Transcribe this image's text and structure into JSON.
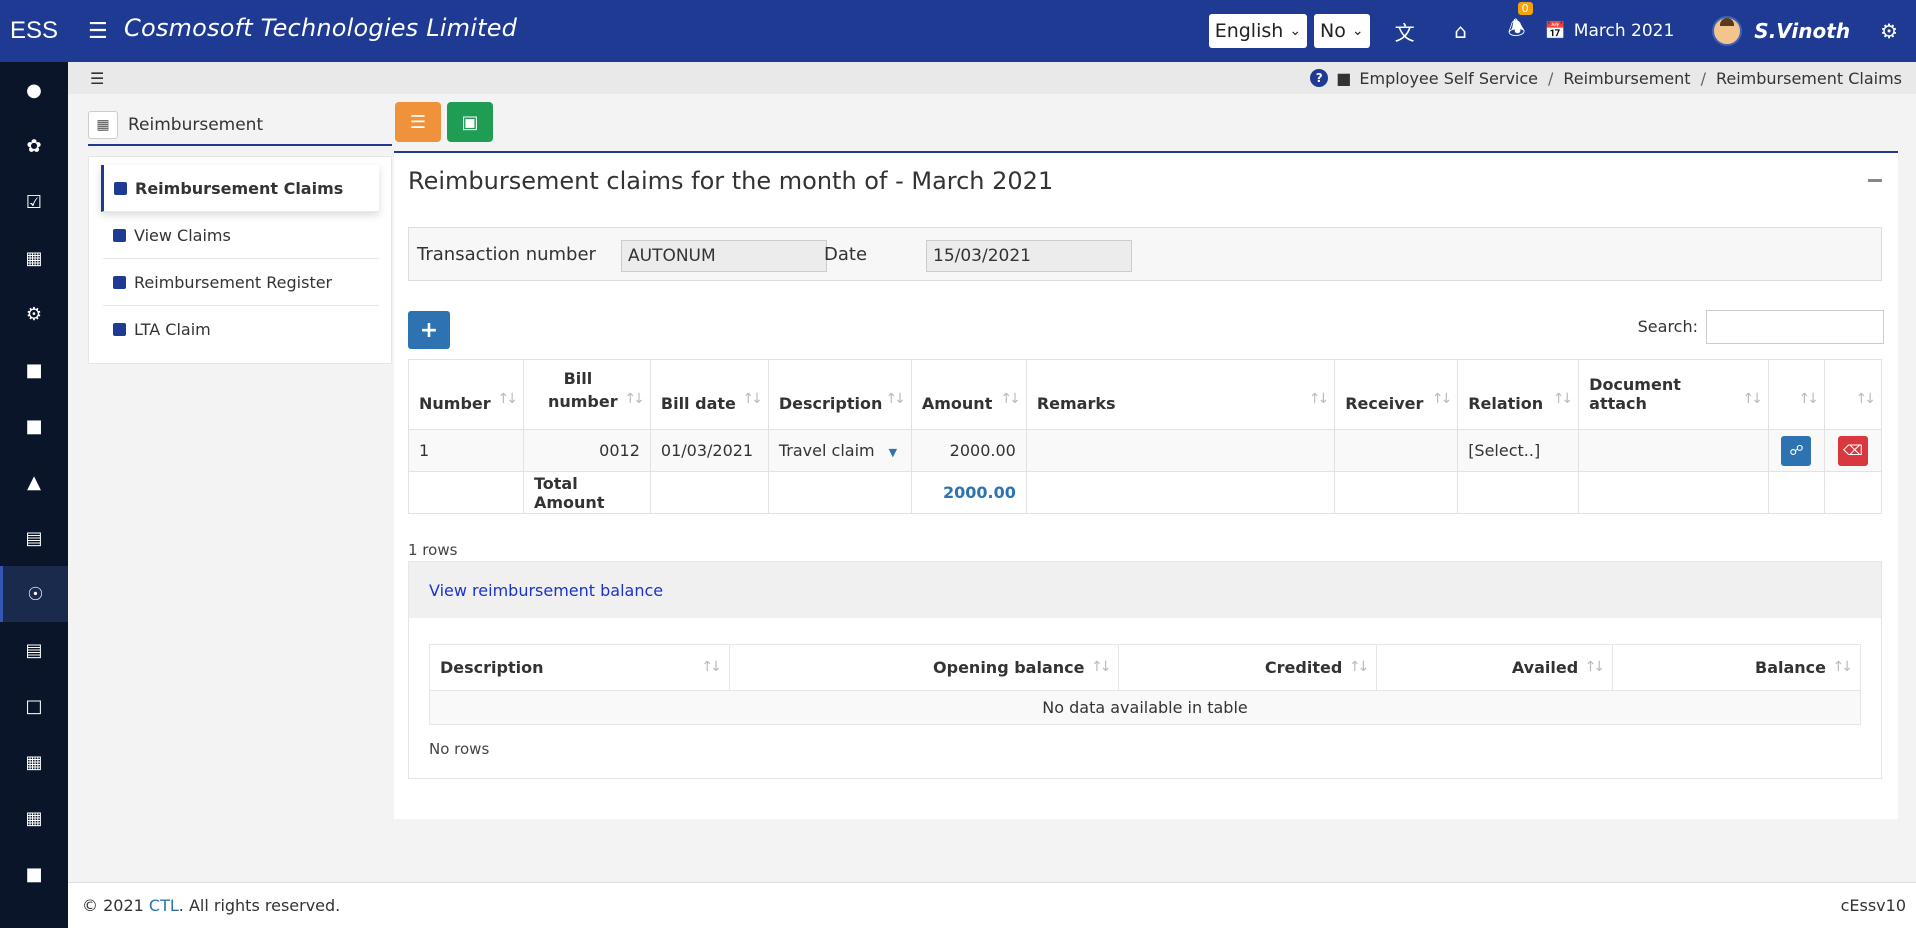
{
  "header": {
    "brand": "ESS",
    "company": "Cosmosoft Technologies Limited",
    "language": "English",
    "option": "No",
    "notification_count": "0",
    "month": "March 2021",
    "user": "S.Vinoth"
  },
  "breadcrumb": [
    "Employee Self Service",
    "Reimbursement",
    "Reimbursement Claims"
  ],
  "left_panel": {
    "title": "Reimbursement",
    "items": [
      "Reimbursement Claims",
      "View Claims",
      "Reimbursement Register",
      "LTA Claim"
    ]
  },
  "main": {
    "title": "Reimbursement claims for the month of - March 2021",
    "transaction_label": "Transaction number",
    "transaction_value": "AUTONUM",
    "date_label": "Date",
    "date_value": "15/03/2021",
    "search_label": "Search:",
    "columns": [
      "Number",
      "Bill number",
      "Bill date",
      "Description",
      "Amount",
      "Remarks",
      "Receiver",
      "Relation",
      "Document attach"
    ],
    "row": {
      "number": "1",
      "bill_number": "0012",
      "bill_date": "01/03/2021",
      "description": "Travel claim",
      "amount": "2000.00",
      "relation": "[Select..]"
    },
    "total_label": "Total Amount",
    "total_value": "2000.00",
    "rows_info": "1 rows"
  },
  "balance": {
    "link": "View reimbursement balance",
    "columns": [
      "Description",
      "Opening balance",
      "Credited",
      "Availed",
      "Balance"
    ],
    "empty": "No data available in table",
    "rows_info": "No rows"
  },
  "footer": {
    "copy_prefix": "© 2021",
    "company_link": "CTL",
    "copy_suffix": ". All rights reserved.",
    "version": "cEssv10"
  }
}
